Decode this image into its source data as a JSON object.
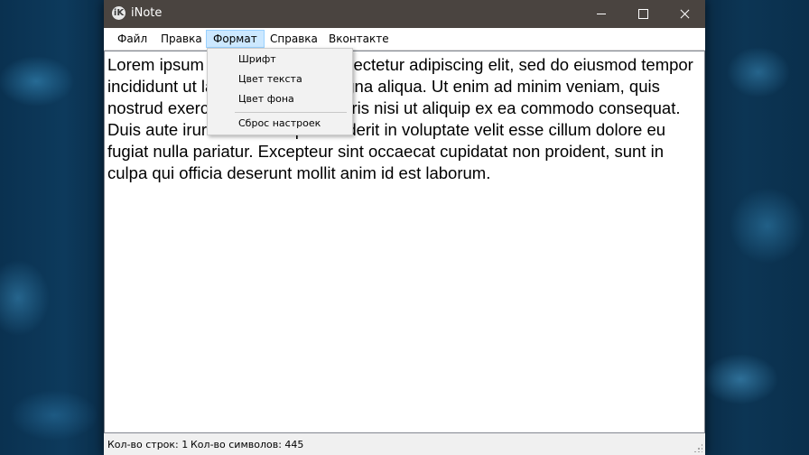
{
  "window": {
    "title": "iNote",
    "icon_letter": "iK"
  },
  "menubar": {
    "items": [
      {
        "label": "Файл"
      },
      {
        "label": "Правка"
      },
      {
        "label": "Формат"
      },
      {
        "label": "Справка"
      },
      {
        "label": "Вконтакте"
      }
    ],
    "active": "Формат"
  },
  "format_menu": {
    "items": [
      {
        "label": "Шрифт"
      },
      {
        "label": "Цвет текста"
      },
      {
        "label": "Цвет фона"
      },
      {
        "label": "Сброс настроек"
      }
    ]
  },
  "editor": {
    "text": "Lorem ipsum dolor sit amet, consectetur adipiscing elit, sed do eiusmod tempor incididunt ut labore et dolore magna aliqua. Ut enim ad minim veniam, quis nostrud exercitation ullamco laboris nisi ut aliquip ex ea commodo consequat. Duis aute irure dolor in reprehenderit in voluptate velit esse cillum dolore eu fugiat nulla pariatur. Excepteur sint occaecat cupidatat non proident, sunt in culpa qui officia deserunt mollit anim id est laborum."
  },
  "statusbar": {
    "lines_label": "Кол-во строк: 1",
    "chars_label": "Кол-во символов: 445"
  },
  "colors": {
    "titlebar": "#4a4440",
    "menu_highlight": "#cce8ff",
    "editor_bg": "#ffffff"
  }
}
